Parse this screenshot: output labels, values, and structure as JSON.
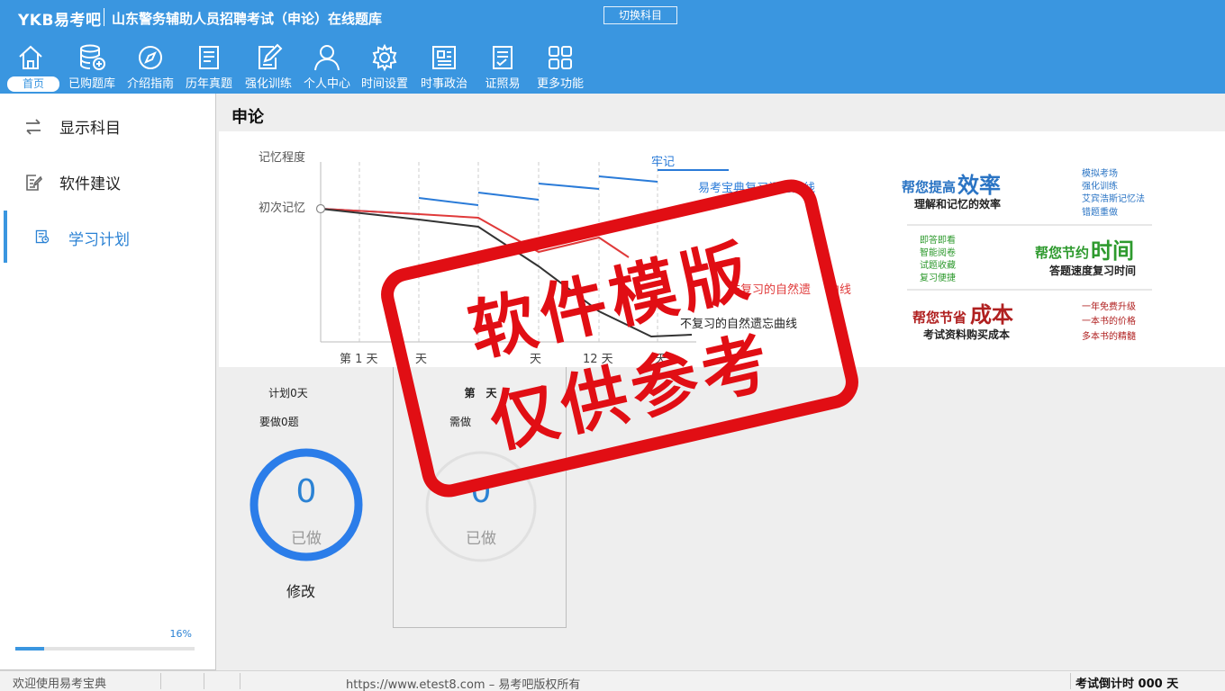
{
  "header": {
    "brand": "YKB易考吧",
    "title": "山东警务辅助人员招聘考试（申论）在线题库",
    "switch_button": "切换科目"
  },
  "nav": {
    "items": [
      {
        "label": "首页",
        "icon": "home-icon"
      },
      {
        "label": "已购题库",
        "icon": "database-icon"
      },
      {
        "label": "介绍指南",
        "icon": "compass-icon"
      },
      {
        "label": "历年真题",
        "icon": "list-icon"
      },
      {
        "label": "强化训练",
        "icon": "edit-icon"
      },
      {
        "label": "个人中心",
        "icon": "user-icon"
      },
      {
        "label": "时间设置",
        "icon": "gear-icon"
      },
      {
        "label": "时事政治",
        "icon": "news-icon"
      },
      {
        "label": "证照易",
        "icon": "checklist-icon"
      },
      {
        "label": "更多功能",
        "icon": "grid-icon"
      }
    ]
  },
  "sidebar": {
    "items": [
      {
        "label": "显示科目",
        "icon": "swap-icon"
      },
      {
        "label": "软件建议",
        "icon": "feedback-icon"
      },
      {
        "label": "学习计划",
        "icon": "plan-icon"
      }
    ],
    "progress_text": "16%",
    "progress_value": 0.16
  },
  "main": {
    "section_title": "申论",
    "banner": {
      "y_label_top": "记忆程度",
      "y_label_mid": "初次记忆",
      "x_labels": [
        "第 1 天",
        "天",
        "天",
        "12 天",
        "天"
      ],
      "label_firm": "牢记",
      "label_ykb": "易考宝典复习记忆曲线",
      "label_red": "非复习的自然遗",
      "label_red_tail": "曲线",
      "label_black": "不复习的自然遗忘曲线",
      "promo": {
        "efficiency_prefix": "帮您提高",
        "efficiency_big": "效率",
        "efficiency_sub": "理解和记忆的效率",
        "efficiency_list": [
          "模拟考场",
          "强化训练",
          "艾宾浩斯记忆法",
          "错题重做"
        ],
        "time_prefix": "帮您节约",
        "time_big": "时间",
        "time_sub": "答题速度复习时间",
        "time_list": [
          "即答即看",
          "智能阅卷",
          "试题收藏",
          "复习便捷"
        ],
        "cost_prefix": "帮您节省",
        "cost_big": "成本",
        "cost_sub": "考试资料购买成本",
        "cost_list": [
          "一年免费升级",
          "一本书的价格",
          "多本书的精髓"
        ]
      }
    },
    "plan_left": {
      "days": "计划0天",
      "need": "要做0题",
      "ring_value": "0",
      "ring_label": "已做",
      "modify": "修改"
    },
    "plan_right": {
      "days": "第　天",
      "need": "需做",
      "ring_value": "0",
      "ring_label": "已做"
    }
  },
  "stamp": {
    "line1": "软件模版",
    "line2": "仅供参考"
  },
  "statusbar": {
    "welcome": "欢迎使用易考宝典",
    "copyright": "https://www.etest8.com – 易考吧版权所有",
    "countdown": "考试倒计时 000 天"
  },
  "colors": {
    "header_bg": "#3a96e0",
    "accent": "#2b82d4",
    "stamp_red": "#e10e14"
  }
}
